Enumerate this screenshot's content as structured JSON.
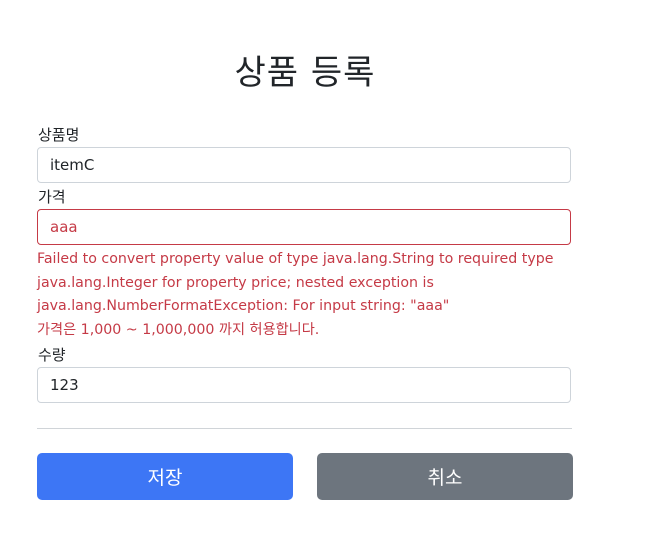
{
  "page": {
    "title": "상품 등록"
  },
  "form": {
    "item_name": {
      "label": "상품명",
      "value": "itemC"
    },
    "price": {
      "label": "가격",
      "value": "aaa",
      "errors": [
        "Failed to convert property value of type java.lang.String to required type",
        "java.lang.Integer for property price; nested exception is",
        "java.lang.NumberFormatException: For input string: \"aaa\"",
        "가격은 1,000 ~ 1,000,000 까지 허용합니다."
      ]
    },
    "quantity": {
      "label": "수량",
      "value": "123"
    }
  },
  "actions": {
    "save_label": "저장",
    "cancel_label": "취소"
  },
  "colors": {
    "primary": "#3d76f5",
    "secondary": "#6d757e",
    "error": "#c53a46"
  }
}
